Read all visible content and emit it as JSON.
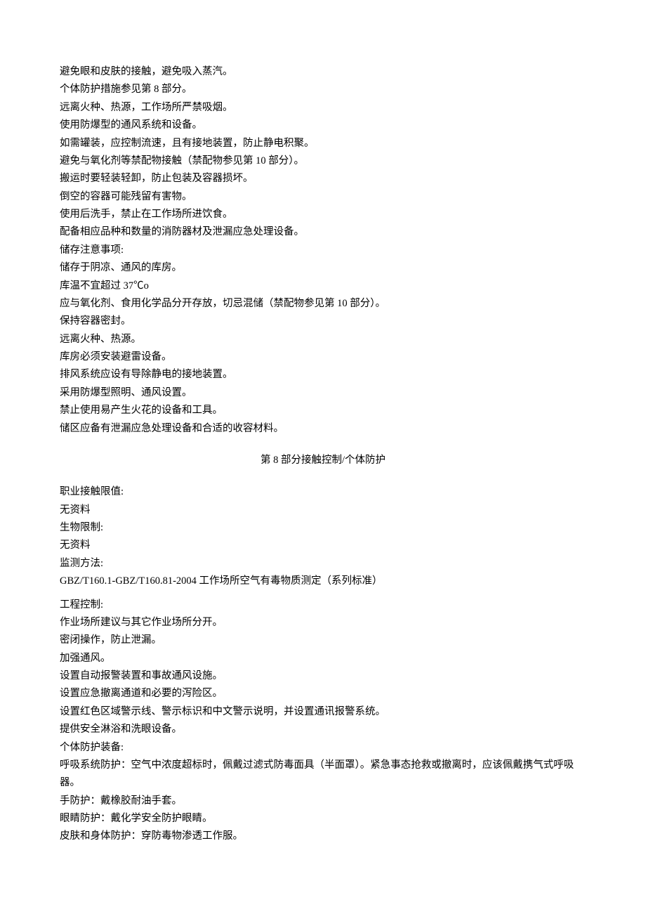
{
  "section7": {
    "lines": [
      "避免眼和皮肤的接触，避免吸入蒸汽。",
      "个体防护措施参见第 8 部分。",
      "远离火种、热源，工作场所严禁吸烟。",
      "使用防爆型的通风系统和设备。",
      "如需罐装，应控制流速，且有接地装置，防止静电积聚。",
      "避免与氧化剂等禁配物接触（禁配物参见第 10 部分）。",
      "搬运时要轻装轻卸，防止包装及容器损坏。",
      "倒空的容器可能残留有害物。",
      "使用后洗手，禁止在工作场所进饮食。",
      "配备相应品种和数量的消防器材及泄漏应急处理设备。",
      "储存注意事项:",
      "储存于阴凉、通风的库房。",
      "库温不宜超过 37℃o",
      "应与氧化剂、食用化学品分开存放，切忌混储（禁配物参见第 10 部分）。",
      "保持容器密封。",
      "远离火种、热源。",
      "库房必须安装避雷设备。",
      "排风系统应设有导除静电的接地装置。",
      "采用防爆型照明、通风设置。",
      "禁止使用易产生火花的设备和工具。",
      "储区应备有泄漏应急处理设备和合适的收容材料。"
    ]
  },
  "section8": {
    "heading": "第 8 部分接触控制/个体防护",
    "block1": [
      "职业接触限值:",
      "无资料",
      "生物限制:",
      "无资料",
      "监测方法:",
      "GBZ/T160.1-GBZ/T160.81-2004 工作场所空气有毒物质测定（系列标准）"
    ],
    "block2": [
      "工程控制:",
      "作业场所建议与其它作业场所分开。",
      "密闭操作，防止泄漏。",
      "加强通风。",
      "设置自动报警装置和事故通风设施。",
      "设置应急撤离通道和必要的泻险区。",
      "设置红色区域警示线、警示标识和中文警示说明，并设置通讯报警系统。",
      "提供安全淋浴和洗眼设备。",
      "个体防护装备:",
      "呼吸系统防护：空气中浓度超标时，佩戴过滤式防毒面具（半面罩）。紧急事态抢救或撤离时，应该佩戴携气式呼吸器。",
      "手防护：戴橡胶耐油手套。",
      "眼睛防护：戴化学安全防护眼睛。",
      "皮肤和身体防护：穿防毒物渗透工作服。"
    ]
  }
}
